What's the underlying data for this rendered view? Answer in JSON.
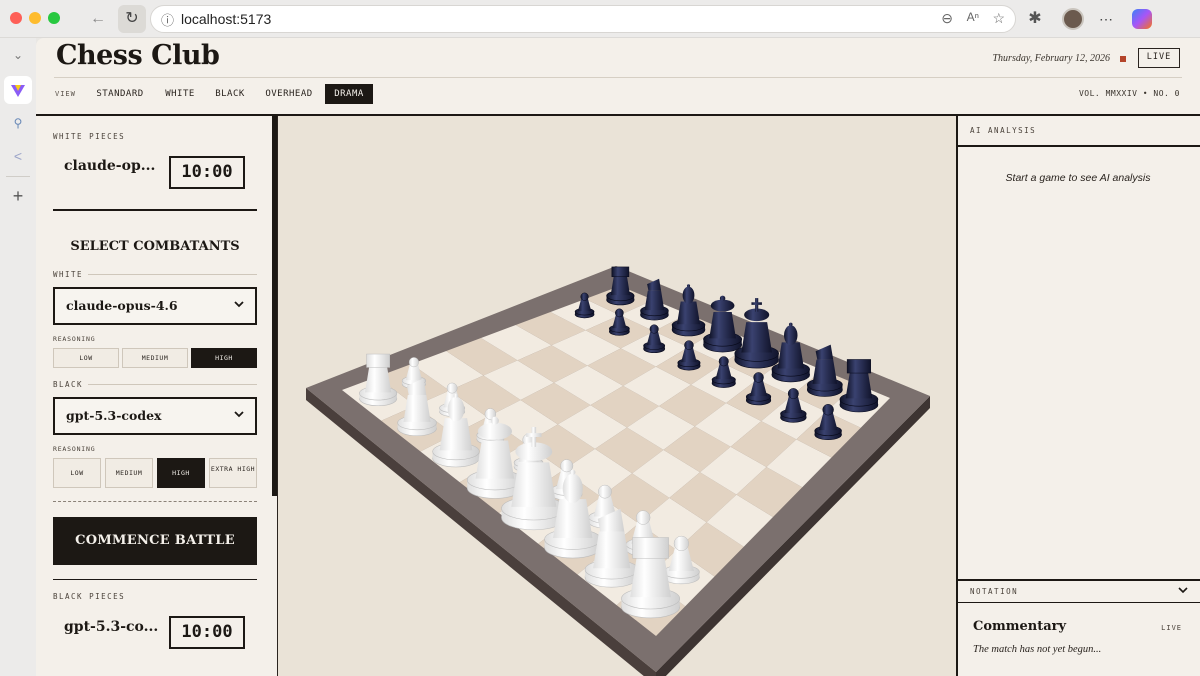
{
  "browser": {
    "url": "localhost:5173",
    "icons": [
      "back-icon",
      "reload-icon",
      "info-icon",
      "zoom-out-icon",
      "read-aloud-icon",
      "favorite-star-icon",
      "extensions-icon",
      "profile-avatar",
      "more-icon",
      "copilot-icon"
    ],
    "sidebar_icons": [
      "tabs-chevron-icon",
      "app-favicon",
      "search-icon",
      "share-icon",
      "add-icon"
    ]
  },
  "header": {
    "title": "Chess Club",
    "date": "Thursday, February 12, 2026",
    "live_badge": "LIVE",
    "view_label": "VIEW",
    "view_tabs": [
      {
        "label": "STANDARD",
        "active": false
      },
      {
        "label": "WHITE",
        "active": false
      },
      {
        "label": "BLACK",
        "active": false
      },
      {
        "label": "OVERHEAD",
        "active": false
      },
      {
        "label": "DRAMA",
        "active": true
      }
    ],
    "volume": "VOL. MMXXIV • NO. 0"
  },
  "left_panel": {
    "white_label": "WHITE PIECES",
    "white_player": "claude-op...",
    "white_clock": "10:00",
    "select_heading": "SELECT COMBATANTS",
    "white_select_label": "WHITE",
    "white_model": "claude-opus-4.6",
    "white_reasoning_label": "REASONING",
    "white_reasoning": [
      {
        "label": "LOW",
        "active": false
      },
      {
        "label": "MEDIUM",
        "active": false
      },
      {
        "label": "HIGH",
        "active": true
      }
    ],
    "black_select_label": "BLACK",
    "black_model": "gpt-5.3-codex",
    "black_reasoning_label": "REASONING",
    "black_reasoning": [
      {
        "label": "LOW",
        "active": false
      },
      {
        "label": "MEDIUM",
        "active": false
      },
      {
        "label": "HIGH",
        "active": true
      },
      {
        "label": "EXTRA HIGH",
        "active": false
      }
    ],
    "commence_button": "COMMENCE BATTLE",
    "black_label": "BLACK PIECES",
    "black_player": "gpt-5.3-co...",
    "black_clock": "10:00"
  },
  "right_panel": {
    "ai_header": "AI ANALYSIS",
    "ai_message": "Start a game to see AI analysis",
    "notation_header": "NOTATION",
    "commentary_title": "Commentary",
    "commentary_live": "LIVE",
    "commentary_message": "The match has not yet begun..."
  },
  "colors": {
    "ink": "#1c1814",
    "paper": "#f4f0ea",
    "board_light": "#f2ebe1",
    "board_dark": "#e2d3c2",
    "white_piece": "#f6f6f4",
    "black_piece": "#1e2342",
    "live_dot": "#b4442a"
  }
}
